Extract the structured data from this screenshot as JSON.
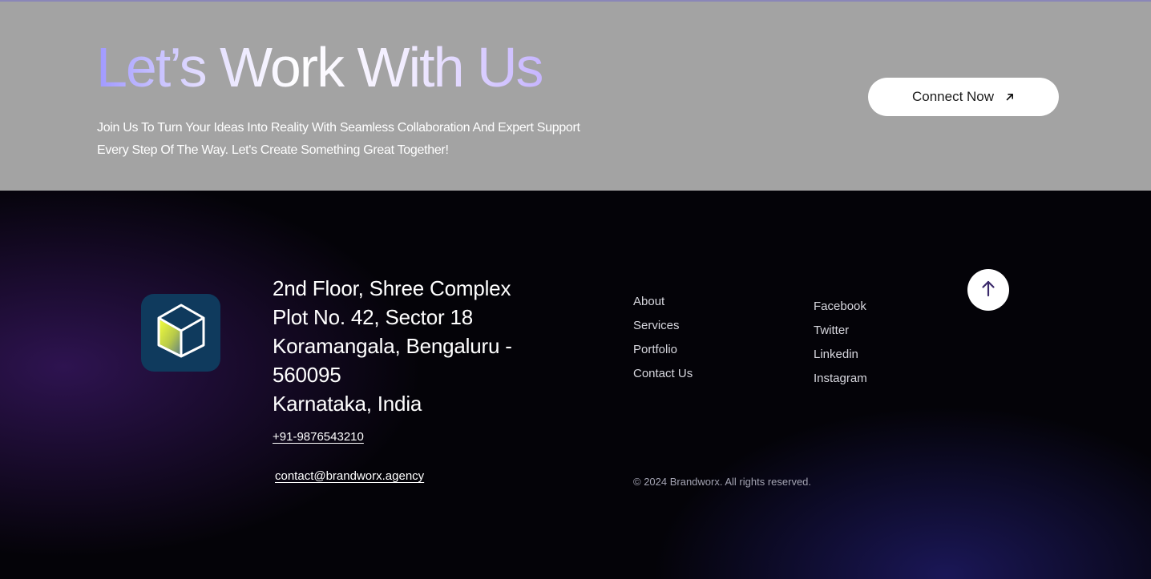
{
  "cta": {
    "title": "Let’s Work With Us",
    "subtitle": "Join Us To Turn Your Ideas Into Reality With Seamless Collaboration And Expert Support Every Step Of The Way. Let's Create Something Great Together!",
    "button_label": "Connect Now",
    "button_icon": "arrow-up-right-icon"
  },
  "footer": {
    "logo_icon": "cube-icon",
    "address": {
      "line1": "2nd Floor, Shree Complex",
      "line2": "Plot No. 42, Sector 18",
      "line3": "Koramangala, Bengaluru -",
      "line4": "560095",
      "line5": "Karnataka, India"
    },
    "phone": "+91-9876543210",
    "email": "contact@brandworx.agency",
    "nav_links": [
      "About",
      "Services",
      "Portfolio",
      "Contact Us"
    ],
    "social_links": [
      "Facebook",
      "Twitter",
      "Linkedin",
      "Instagram"
    ],
    "copyright": "© 2024 Brandworx. All rights reserved.",
    "back_to_top_icon": "arrow-up-icon"
  },
  "colors": {
    "cta_background": "#a3a3a3",
    "footer_background": "#040308",
    "logo_background": "#0f3a5d",
    "title_gradient": [
      "#9f98ff",
      "#ffffff",
      "#c6b5ff"
    ],
    "arrow_color": "#3b2a6b"
  }
}
